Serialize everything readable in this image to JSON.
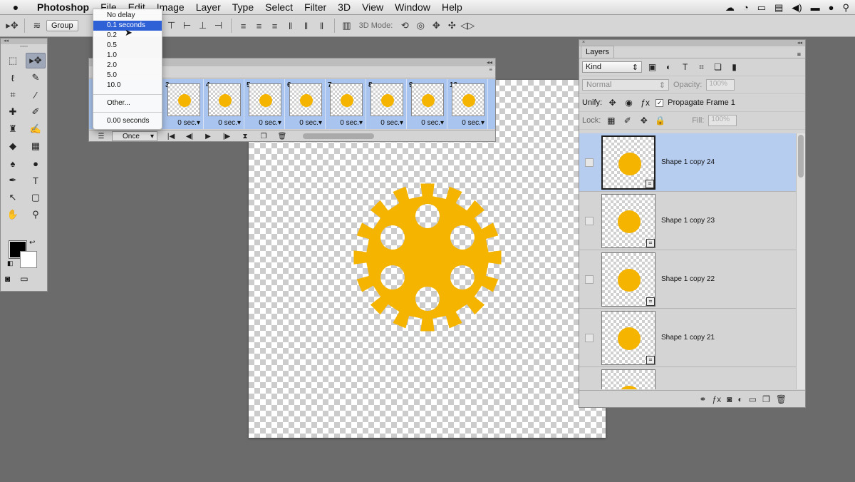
{
  "menubar": {
    "app_name": "Photoshop",
    "items": [
      "File",
      "Edit",
      "Image",
      "Layer",
      "Type",
      "Select",
      "Filter",
      "3D",
      "View",
      "Window",
      "Help"
    ]
  },
  "options_bar": {
    "auto_select_value": "Group",
    "mode_3d_label": "3D Mode:"
  },
  "delay_menu": {
    "items": [
      "No delay",
      "0.1 seconds",
      "0.2",
      "0.5",
      "1.0",
      "2.0",
      "5.0",
      "10.0"
    ],
    "selected_index": 1,
    "other_label": "Other...",
    "current_label": "0.00 seconds"
  },
  "timeline": {
    "frames": [
      {
        "number": "3",
        "delay": "0 sec."
      },
      {
        "number": "4",
        "delay": "0 sec."
      },
      {
        "number": "5",
        "delay": "0 sec."
      },
      {
        "number": "6",
        "delay": "0 sec."
      },
      {
        "number": "7",
        "delay": "0 sec."
      },
      {
        "number": "8",
        "delay": "0 sec."
      },
      {
        "number": "9",
        "delay": "0 sec."
      },
      {
        "number": "10",
        "delay": "0 sec."
      }
    ],
    "loop_label": "Once"
  },
  "layers_panel": {
    "tab_label": "Layers",
    "kind_label": "Kind",
    "blend_mode": "Normal",
    "opacity_label": "Opacity:",
    "opacity_value": "100%",
    "unify_label": "Unify:",
    "propagate_label": "Propagate Frame 1",
    "lock_label": "Lock:",
    "fill_label": "Fill:",
    "fill_value": "100%",
    "layers": [
      {
        "name": "Shape 1 copy 24",
        "selected": true
      },
      {
        "name": "Shape 1 copy 23",
        "selected": false
      },
      {
        "name": "Shape 1 copy 22",
        "selected": false
      },
      {
        "name": "Shape 1 copy 21",
        "selected": false
      },
      {
        "name": "",
        "selected": false
      }
    ]
  },
  "colors": {
    "accent_orange": "#f5b400",
    "selection_blue": "#2f61d6",
    "frame_strip_blue": "#a9c4ee"
  }
}
